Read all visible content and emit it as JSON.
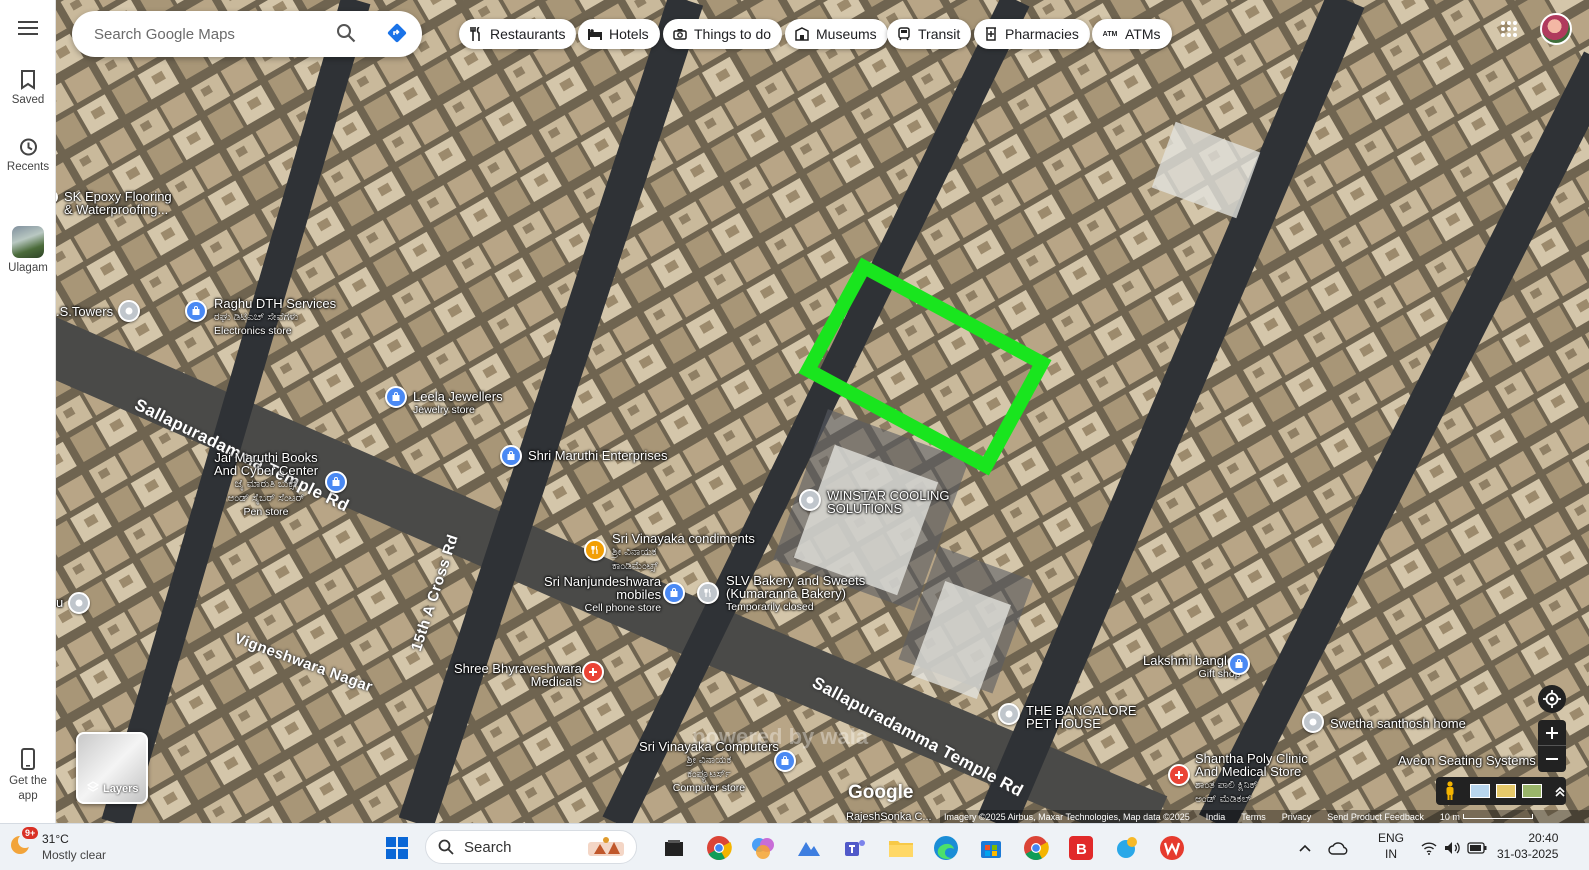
{
  "sidebar": {
    "saved_label": "Saved",
    "recents_label": "Recents",
    "ulagam_label": "Ulagam",
    "getapp_label": "Get the app"
  },
  "search": {
    "placeholder": "Search Google Maps"
  },
  "chips": [
    {
      "label": "Restaurants",
      "icon": "fork-knife-icon"
    },
    {
      "label": "Hotels",
      "icon": "bed-icon"
    },
    {
      "label": "Things to do",
      "icon": "camera-icon"
    },
    {
      "label": "Museums",
      "icon": "museum-icon"
    },
    {
      "label": "Transit",
      "icon": "train-icon"
    },
    {
      "label": "Pharmacies",
      "icon": "pharmacy-icon"
    },
    {
      "label": "ATMs",
      "icon": "atm-icon"
    }
  ],
  "chip_atm_badge": "ATM",
  "places": {
    "sk_epoxy": "SK Epoxy Flooring & Waterproofing...",
    "s_towers": ".S.Towers",
    "raghu": "Raghu DTH Services",
    "raghu_kn": "ರಘು ಡಿಟಿಎಚ್ ಸೇವೆಗಳು",
    "raghu_sub": "Electronics store",
    "leela": "Leela Jewellers",
    "leela_sub": "Jewelry store",
    "jai_maruthi_1": "Jai Maruthi Books",
    "jai_maruthi_2": "And Cyber Center",
    "jai_maruthi_kn_1": "ಜೈ ಮಾರುತಿ ಬುಕ್ಸ್",
    "jai_maruthi_kn_2": "ಅಂಡ್ ಸೈಬರ್ ಸೆಂಟರ್",
    "jai_maruthi_sub": "Pen store",
    "shri_maruthi": "Shri Maruthi Enterprises",
    "winstar_1": "WINSTAR COOLING",
    "winstar_2": "SOLUTIONS",
    "sri_vinayaka_cond": "Sri Vinayaka condiments",
    "sri_vinayaka_cond_kn_1": "ಶ್ರೀ ವಿನಾಯಕ",
    "sri_vinayaka_cond_kn_2": "ಕಾಂಡಿಮೆಂಟ್ಸ್",
    "nanjundeshwara_1": "Sri Nanjundeshwara",
    "nanjundeshwara_2": "mobiles",
    "nanjundeshwara_sub": "Cell phone store",
    "slv_1": "SLV Bakery and Sweets",
    "slv_2": "(Kumaranna Bakery)",
    "slv_sub": "Temporarily closed",
    "u_label": "u",
    "bhyraveshwara_1": "Shree Bhyraveshwara",
    "bhyraveshwara_2": "Medicals",
    "lakshmi": "Lakshmi bangles",
    "lakshmi_sub": "Gift shop",
    "bangalore_pet_1": "THE BANGALORE",
    "bangalore_pet_2": "PET HOUSE",
    "swetha": "Swetha santhosh home",
    "aveon": "Aveon Seating Systems",
    "sri_vinayaka_comp": "Sri Vinayaka Computers",
    "sri_vinayaka_comp_kn_1": "ಶ್ರೀ ವಿನಾಯಕ",
    "sri_vinayaka_comp_kn_2": "ಕಂಪ್ಯೂಟರ್ಸ್",
    "sri_vinayaka_comp_sub": "Computer store",
    "shantha_1": "Shantha Poly Clinic",
    "shantha_2": "And Medical Store",
    "shantha_kn_1": "ಶಾಂತ ಪಾಲಿ ಕ್ಲಿನಿಕ್",
    "shantha_kn_2": "ಅಂಡ್ ಮೆಡಿಕಲ್",
    "rajesh": "RajeshSonka C..."
  },
  "roads": {
    "sallapuradamma_1": "Sallapuradamma Temple Rd",
    "sallapuradamma_2": "Sallapuradamma Temple Rd",
    "vigneshwara": "Vigneshwara Nagar",
    "cross_rd": "15th A Cross Rd"
  },
  "map_footer": {
    "imagery": "Imagery ©2025 Airbus, Maxar Technologies, Map data ©2025",
    "india": "India",
    "terms": "Terms",
    "privacy": "Privacy",
    "feedback": "Send Product Feedback",
    "scale": "10 m"
  },
  "layers_label": "Layers",
  "google_logo": "Google",
  "watermark": "powered by wala",
  "taskbar": {
    "weather_temp": "31°C",
    "weather_desc": "Mostly clear",
    "weather_badge": "9+",
    "search_label": "Search",
    "lang_1": "ENG",
    "lang_2": "IN",
    "time": "20:40",
    "date": "31-03-2025"
  },
  "colors": {
    "highlight_box": "#19e51e",
    "pin_blue": "#4a89f3",
    "pin_red": "#ea4335",
    "pin_orange": "#f29f05"
  }
}
